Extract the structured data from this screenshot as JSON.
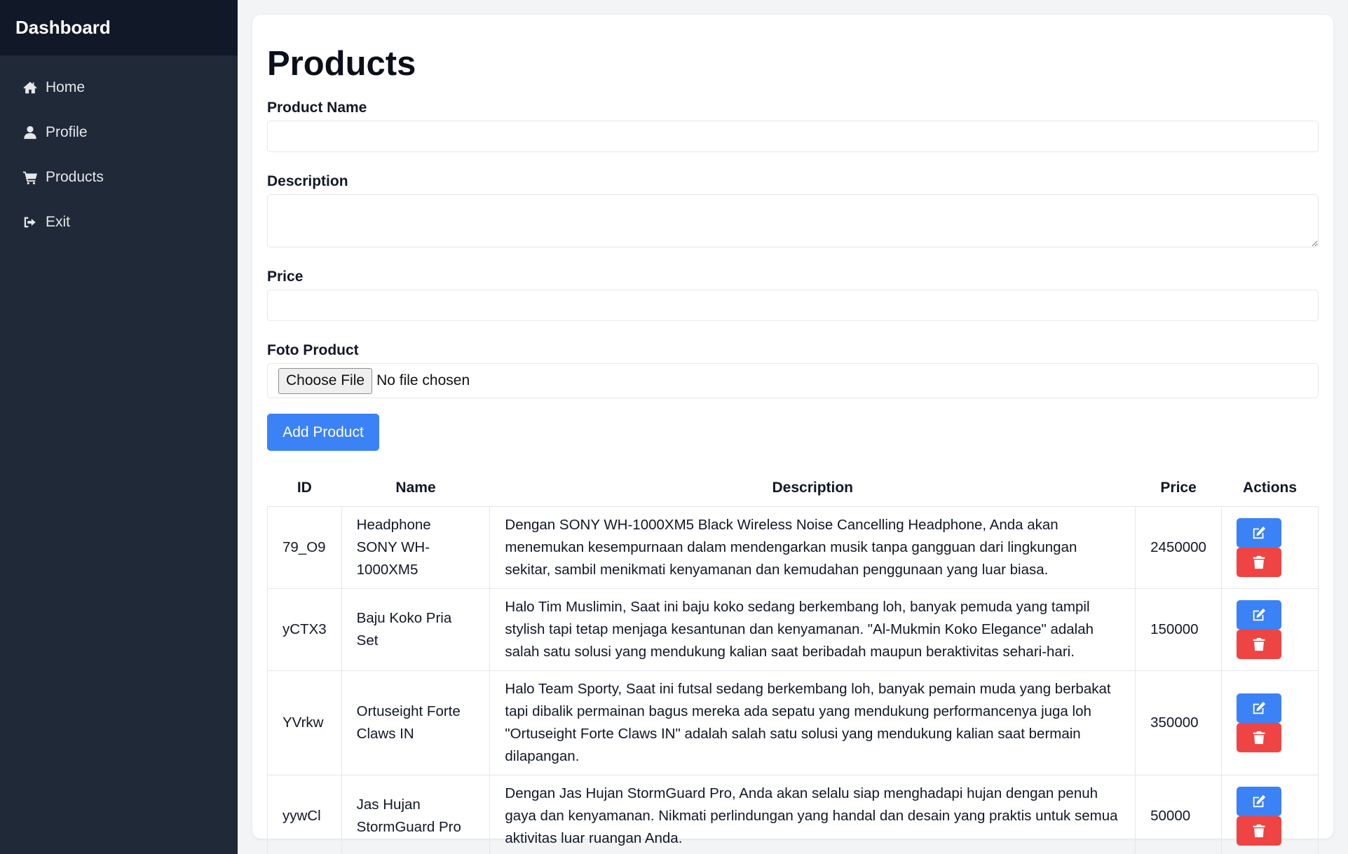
{
  "sidebar": {
    "title": "Dashboard",
    "items": [
      {
        "label": "Home",
        "icon": "home-icon"
      },
      {
        "label": "Profile",
        "icon": "user-icon"
      },
      {
        "label": "Products",
        "icon": "cart-icon"
      },
      {
        "label": "Exit",
        "icon": "sign-out-icon"
      }
    ]
  },
  "main": {
    "title": "Products",
    "form": {
      "name_label": "Product Name",
      "name_value": "",
      "description_label": "Description",
      "description_value": "",
      "price_label": "Price",
      "price_value": "",
      "photo_label": "Foto Product",
      "file_button": "Choose File",
      "file_status": "No file chosen",
      "submit": "Add Product"
    },
    "table": {
      "headers": [
        "ID",
        "Name",
        "Description",
        "Price",
        "Actions"
      ],
      "rows": [
        {
          "id": "79_O9",
          "name": "Headphone SONY WH-1000XM5",
          "description": "Dengan SONY WH-1000XM5 Black Wireless Noise Cancelling Headphone, Anda akan menemukan kesempurnaan dalam mendengarkan musik tanpa gangguan dari lingkungan sekitar, sambil menikmati kenyamanan dan kemudahan penggunaan yang luar biasa.",
          "price": "2450000"
        },
        {
          "id": "yCTX3",
          "name": "Baju Koko Pria Set",
          "description": "Halo Tim Muslimin, Saat ini baju koko sedang berkembang loh, banyak pemuda yang tampil stylish tapi tetap menjaga kesantunan dan kenyamanan. \"Al-Mukmin Koko Elegance\" adalah salah satu solusi yang mendukung kalian saat beribadah maupun beraktivitas sehari-hari.",
          "price": "150000"
        },
        {
          "id": "YVrkw",
          "name": "Ortuseight Forte Claws IN",
          "description": "Halo Team Sporty, Saat ini futsal sedang berkembang loh, banyak pemain muda yang berbakat tapi dibalik permainan bagus mereka ada sepatu yang mendukung performancenya juga loh \"Ortuseight Forte Claws IN\" adalah salah satu solusi yang mendukung kalian saat bermain dilapangan.",
          "price": "350000"
        },
        {
          "id": "yywCl",
          "name": "Jas Hujan StormGuard Pro",
          "description": "Dengan Jas Hujan StormGuard Pro, Anda akan selalu siap menghadapi hujan dengan penuh gaya dan kenyamanan. Nikmati perlindungan yang handal dan desain yang praktis untuk semua aktivitas luar ruangan Anda.",
          "price": "50000"
        }
      ],
      "row_actions": {
        "edit_icon": "edit-icon",
        "delete_icon": "trash-icon"
      }
    }
  },
  "colors": {
    "sidebar_bg": "#1f2937",
    "sidebar_header_bg": "#111827",
    "primary": "#3b82f6",
    "danger": "#ef4444"
  }
}
